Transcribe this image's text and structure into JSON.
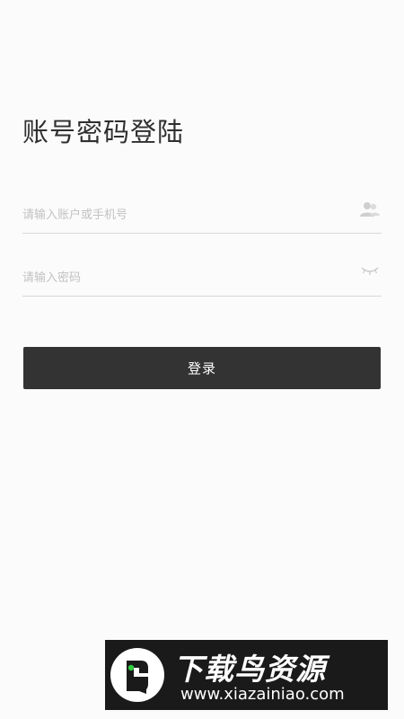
{
  "login": {
    "title": "账号密码登陆",
    "account_placeholder": "请输入账户或手机号",
    "account_icon": "user-icon",
    "password_placeholder": "请输入密码",
    "password_icon": "eye-closed-icon",
    "login_button": "登录"
  },
  "watermark": {
    "brand": "下载鸟资源",
    "url": "www.xiazainiao.com"
  },
  "colors": {
    "background": "#fbfbfb",
    "button": "#333333",
    "button_text": "#ffffff",
    "divider": "#d8d8d8",
    "placeholder": "#c2c2c2",
    "watermark_accent": "#2ecc40"
  }
}
